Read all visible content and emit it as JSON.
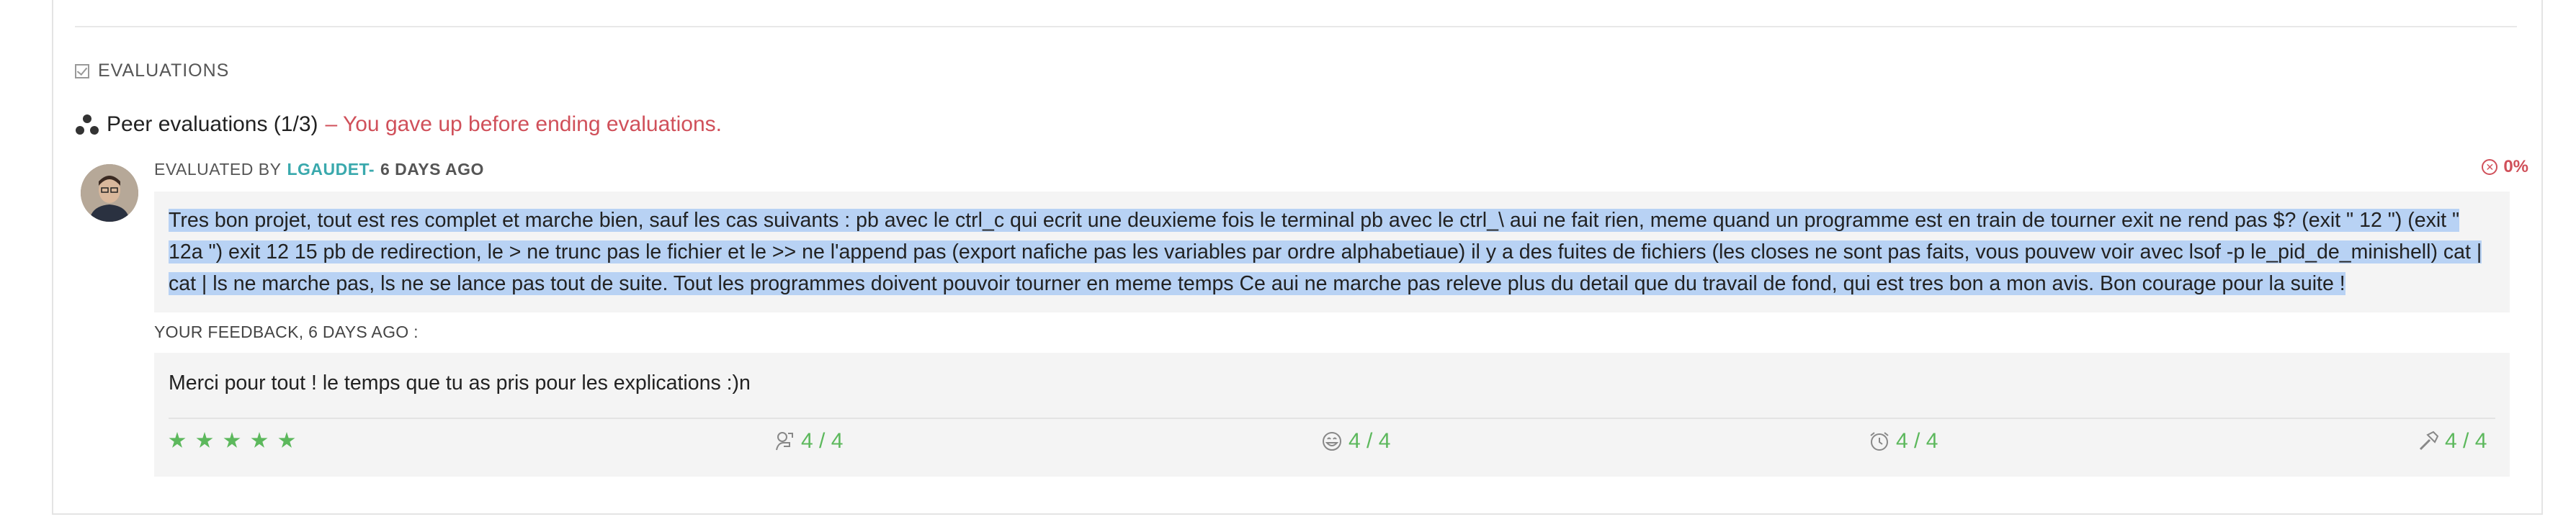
{
  "section": {
    "title": "EVALUATIONS"
  },
  "peer": {
    "title": "Peer evaluations (1/3)",
    "warning": "– You gave up before ending evaluations."
  },
  "evaluation": {
    "evaluated_by_label": "EVALUATED BY",
    "login": "LGAUDET-",
    "ago": "6 DAYS AGO",
    "score": "0%",
    "comment": "Tres bon projet, tout est res complet et marche bien, sauf les cas suivants : pb avec le ctrl_c qui ecrit une deuxieme fois le terminal pb avec le ctrl_\\ aui ne fait rien, meme quand un programme est en train de tourner exit ne rend pas $? (exit \" 12 \") (exit \" 12a \") exit 12 15 pb de redirection, le > ne trunc pas le fichier et le >> ne l'append pas (export nafiche pas les variables par ordre alphabetiaue) il y a des fuites de fichiers (les closes ne sont pas faits, vous pouvew voir avec lsof -p le_pid_de_minishell) cat | cat | ls ne marche pas, ls ne se lance pas tout de suite. Tout les programmes doivent pouvoir tourner en meme temps Ce aui ne marche pas releve plus du detail que du travail de fond, qui est tres bon a mon avis. Bon courage pour la suite !"
  },
  "feedback": {
    "label": "YOUR FEEDBACK, 6 DAYS AGO :",
    "text": "Merci pour tout ! le temps que tu as pris pour les explications :)n",
    "stars": 5,
    "metrics": [
      {
        "icon": "nice-icon",
        "value": "4 / 4"
      },
      {
        "icon": "smile-icon",
        "value": "4 / 4"
      },
      {
        "icon": "alarm-clock-icon",
        "value": "4 / 4"
      },
      {
        "icon": "hammer-icon",
        "value": "4 / 4"
      }
    ]
  },
  "colors": {
    "accent": "#3aa9ad",
    "danger": "#d0505a",
    "success": "#5cb85c",
    "highlight": "#b8d2f4"
  }
}
